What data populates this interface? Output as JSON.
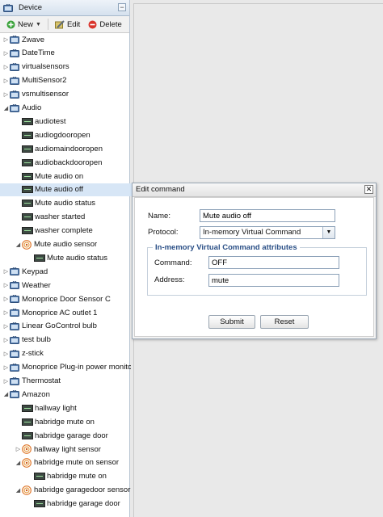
{
  "panel": {
    "title": "Device",
    "collapse_glyph": "−"
  },
  "toolbar": {
    "new_label": "New",
    "edit_label": "Edit",
    "delete_label": "Delete"
  },
  "tree": [
    {
      "label": "Zwave",
      "type": "device",
      "level": 0,
      "toggle": "right",
      "selected": false
    },
    {
      "label": "DateTime",
      "type": "device",
      "level": 0,
      "toggle": "right",
      "selected": false
    },
    {
      "label": "virtualsensors",
      "type": "device",
      "level": 0,
      "toggle": "right",
      "selected": false
    },
    {
      "label": "MultiSensor2",
      "type": "device",
      "level": 0,
      "toggle": "right",
      "selected": false
    },
    {
      "label": "vsmultisensor",
      "type": "device",
      "level": 0,
      "toggle": "right",
      "selected": false
    },
    {
      "label": "Audio",
      "type": "device",
      "level": 0,
      "toggle": "down",
      "selected": false
    },
    {
      "label": "audiotest",
      "type": "command",
      "level": 1,
      "toggle": "",
      "selected": false
    },
    {
      "label": "audiogdooropen",
      "type": "command",
      "level": 1,
      "toggle": "",
      "selected": false
    },
    {
      "label": "audiomaindooropen",
      "type": "command",
      "level": 1,
      "toggle": "",
      "selected": false
    },
    {
      "label": "audiobackdooropen",
      "type": "command",
      "level": 1,
      "toggle": "",
      "selected": false
    },
    {
      "label": "Mute audio on",
      "type": "command",
      "level": 1,
      "toggle": "",
      "selected": false
    },
    {
      "label": "Mute audio off",
      "type": "command",
      "level": 1,
      "toggle": "",
      "selected": true
    },
    {
      "label": "Mute audio status",
      "type": "command",
      "level": 1,
      "toggle": "",
      "selected": false
    },
    {
      "label": "washer started",
      "type": "command",
      "level": 1,
      "toggle": "",
      "selected": false
    },
    {
      "label": "washer complete",
      "type": "command",
      "level": 1,
      "toggle": "",
      "selected": false
    },
    {
      "label": "Mute audio sensor",
      "type": "sensor",
      "level": 1,
      "toggle": "down",
      "selected": false
    },
    {
      "label": "Mute audio status",
      "type": "command",
      "level": 2,
      "toggle": "",
      "selected": false
    },
    {
      "label": "Keypad",
      "type": "device",
      "level": 0,
      "toggle": "right",
      "selected": false
    },
    {
      "label": "Weather",
      "type": "device",
      "level": 0,
      "toggle": "right",
      "selected": false
    },
    {
      "label": "Monoprice Door Sensor C",
      "type": "device",
      "level": 0,
      "toggle": "right",
      "selected": false
    },
    {
      "label": "Monoprice AC outlet 1",
      "type": "device",
      "level": 0,
      "toggle": "right",
      "selected": false
    },
    {
      "label": "Linear GoControl bulb",
      "type": "device",
      "level": 0,
      "toggle": "right",
      "selected": false
    },
    {
      "label": "test bulb",
      "type": "device",
      "level": 0,
      "toggle": "right",
      "selected": false
    },
    {
      "label": "z-stick",
      "type": "device",
      "level": 0,
      "toggle": "right",
      "selected": false
    },
    {
      "label": "Monoprice Plug-in power monitor",
      "type": "device",
      "level": 0,
      "toggle": "right",
      "selected": false
    },
    {
      "label": "Thermostat",
      "type": "device",
      "level": 0,
      "toggle": "right",
      "selected": false
    },
    {
      "label": "Amazon",
      "type": "device",
      "level": 0,
      "toggle": "down",
      "selected": false
    },
    {
      "label": "hallway light",
      "type": "command",
      "level": 1,
      "toggle": "",
      "selected": false
    },
    {
      "label": "habridge mute on",
      "type": "command",
      "level": 1,
      "toggle": "",
      "selected": false
    },
    {
      "label": "habridge garage door",
      "type": "command",
      "level": 1,
      "toggle": "",
      "selected": false
    },
    {
      "label": "hallway light sensor",
      "type": "sensor",
      "level": 1,
      "toggle": "right",
      "selected": false
    },
    {
      "label": "habridge mute on sensor",
      "type": "sensor",
      "level": 1,
      "toggle": "down",
      "selected": false
    },
    {
      "label": "habridge mute on",
      "type": "command",
      "level": 2,
      "toggle": "",
      "selected": false
    },
    {
      "label": "habridge garagedoor sensor",
      "type": "sensor",
      "level": 1,
      "toggle": "down",
      "selected": false
    },
    {
      "label": "habridge garage door",
      "type": "command",
      "level": 2,
      "toggle": "",
      "selected": false
    }
  ],
  "dialog": {
    "title": "Edit command",
    "close_glyph": "✕",
    "name_label": "Name:",
    "name_value": "Mute audio off",
    "protocol_label": "Protocol:",
    "protocol_value": "In-memory Virtual Command",
    "attributes_legend": "In-memory Virtual Command attributes",
    "command_label": "Command:",
    "command_value": "OFF",
    "address_label": "Address:",
    "address_value": "mute",
    "submit_label": "Submit",
    "reset_label": "Reset"
  },
  "colors": {
    "selection": "#d7e6f6",
    "accent": "#2a4f86",
    "new_icon": "#3aa23a",
    "delete_icon": "#d9342b"
  },
  "icons": {
    "device": "tv-icon",
    "command": "terminal-icon",
    "sensor": "sensor-icon",
    "new": "plus-icon",
    "edit": "wrench-icon",
    "delete": "delete-icon"
  }
}
